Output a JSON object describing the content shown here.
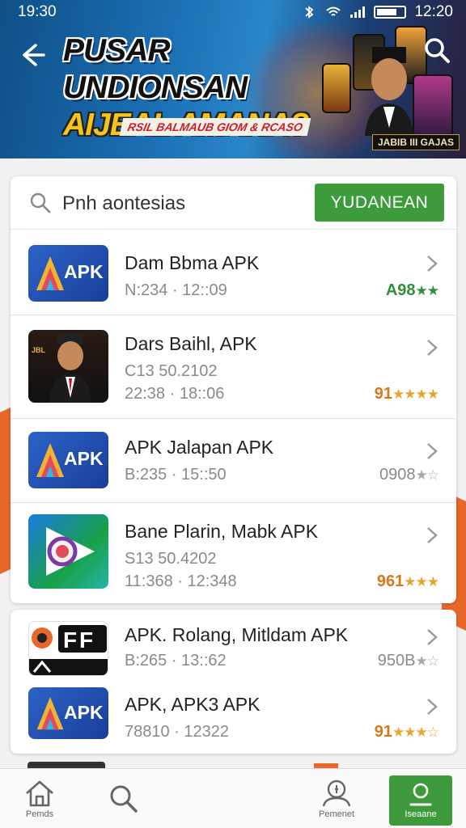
{
  "status": {
    "time": "19:30",
    "clock_right": "12:20"
  },
  "banner": {
    "title_line1": "PUSAR UNDIONSAN",
    "title_line2": "AIJEAL AMANA?",
    "subtitle": "RSIL BALMAUB GIOM & RCASO",
    "tag": "JABIB III GAJAS"
  },
  "search": {
    "placeholder": "Pnh aontesias",
    "button_label": "YUDANEAN"
  },
  "apps": [
    {
      "name": "Dam Bbma APK",
      "meta1": "N:234 · 12::09",
      "meta2": "",
      "rating": "A98",
      "stars": "★★",
      "rating_color": "#2f8f3a"
    },
    {
      "name": "Dars Baihl, APK",
      "meta1": "C13 50.2102",
      "meta2": "22:38 · 18::06",
      "rating": "91",
      "stars": "★★★★",
      "rating_color": "#d9771b"
    },
    {
      "name": "APK Jalapan APK",
      "meta1": "B:235 · 15::50",
      "meta2": "",
      "rating": "0908",
      "stars": "★☆",
      "rating_color": "#8a8a8a"
    },
    {
      "name": "Bane Plarin, Mabk APK",
      "meta1": "S13 50.4202",
      "meta2": "11:368 · 12:348",
      "rating": "961",
      "stars": "★★★",
      "rating_color": "#d9771b"
    },
    {
      "name": "APK. Rolang, Mitldam APK",
      "meta1": "B:265 · 13::62",
      "meta2": "",
      "rating": "950B",
      "stars": "★☆",
      "rating_color": "#8a8a8a"
    },
    {
      "name": "APK, APK3 APK",
      "meta1": "78810 · 12322",
      "meta2": "",
      "rating": "91",
      "stars": "★★★☆",
      "rating_color": "#d9771b"
    }
  ],
  "icons": {
    "apk_text": "APK",
    "photo_badge": "JBL"
  },
  "nav": {
    "items": [
      {
        "label": "Pemds",
        "icon": "home-icon"
      },
      {
        "label": "",
        "icon": "search-icon"
      },
      {
        "label": "Pemenet",
        "icon": "profile-icon"
      },
      {
        "label": "Iseaane",
        "icon": "account-icon"
      }
    ]
  },
  "colors": {
    "accent_green": "#3d9b3b",
    "banner_blue": "#1a6fb3",
    "stripe_orange": "#e8672a"
  }
}
